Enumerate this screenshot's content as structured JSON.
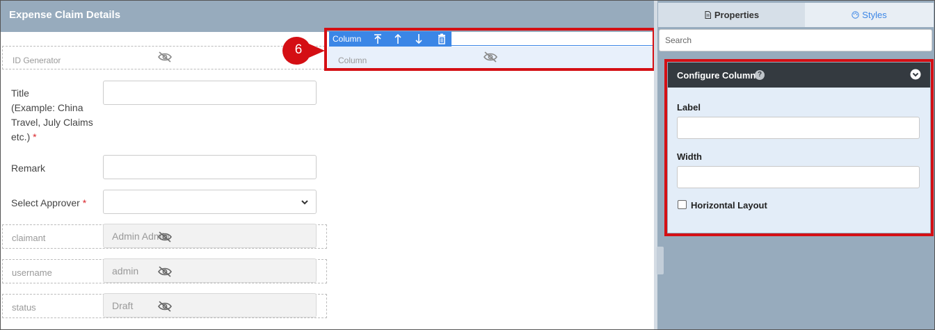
{
  "canvas": {
    "title": "Expense Claim Details",
    "id_generator": {
      "label": "ID Generator"
    },
    "fields": {
      "title": {
        "label_lines": [
          "Title",
          "(Example: China",
          "Travel, July Claims",
          "etc.)"
        ],
        "required_mark": "*",
        "value": ""
      },
      "remark": {
        "label": "Remark",
        "value": ""
      },
      "approver": {
        "label": "Select Approver",
        "required_mark": "*",
        "value": ""
      }
    },
    "hidden_fields": [
      {
        "label": "claimant",
        "value": "Admin Admin"
      },
      {
        "label": "username",
        "value": "admin"
      },
      {
        "label": "status",
        "value": "Draft"
      }
    ]
  },
  "column_component": {
    "toolbar_label": "Column",
    "toolbar_buttons": [
      "move-top-icon",
      "move-up-icon",
      "move-down-icon",
      "delete-icon"
    ],
    "body_label": "Column"
  },
  "callout": {
    "number": "6",
    "color": "#d40f14"
  },
  "properties_panel": {
    "tabs": [
      {
        "label": "Properties",
        "icon": "document-icon",
        "active": true
      },
      {
        "label": "Styles",
        "icon": "palette-icon",
        "active": false
      }
    ],
    "search": {
      "placeholder": "Search",
      "value": ""
    },
    "config": {
      "title": "Configure Column",
      "help": "?",
      "label_field": {
        "label": "Label",
        "value": ""
      },
      "width_field": {
        "label": "Width",
        "value": ""
      },
      "horizontal_layout": {
        "label": "Horizontal Layout",
        "checked": false
      }
    }
  },
  "colors": {
    "header_bg": "#97abbd",
    "accent_blue": "#3b86e6",
    "highlight_red": "#d40f14",
    "config_header": "#343a40"
  }
}
